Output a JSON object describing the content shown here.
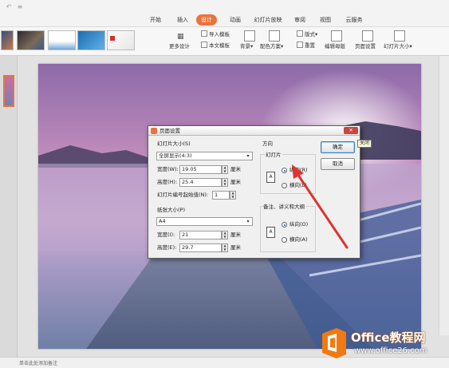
{
  "tabs": {
    "start": "开始",
    "insert": "插入",
    "design": "设计",
    "animation": "动画",
    "slideshow": "幻灯片放映",
    "review": "审阅",
    "view": "视图",
    "cloud": "云服务"
  },
  "ribbon": {
    "more_design": "更多设计",
    "import_template": "导入模板",
    "body_font": "本文模板",
    "background": "背景",
    "color_scheme": "配色方案",
    "layout": "版式",
    "reset": "重置",
    "edit_master": "编辑母版",
    "page_setup": "页面设置",
    "slide_size": "幻灯片大小"
  },
  "dialog": {
    "title": "页面设置",
    "slide_size_label": "幻灯片大小(S)",
    "slide_size_value": "全屏显示(4:3)",
    "width_label": "宽度(W):",
    "width_value": "19.05",
    "width_unit": "厘米",
    "height_label": "高度(H):",
    "height_value": "25.4",
    "height_unit": "厘米",
    "start_num_label": "幻灯片编号起始值(N):",
    "start_num_value": "1",
    "paper_label": "纸张大小(P)",
    "paper_value": "A4",
    "pwidth_label": "宽度(I):",
    "pwidth_value": "21",
    "pwidth_unit": "厘米",
    "pheight_label": "高度(E):",
    "pheight_value": "29.7",
    "pheight_unit": "厘米",
    "orientation_label": "方向",
    "slides_label": "幻灯片",
    "slides_portrait": "纵向(R)",
    "slides_landscape": "横向(L)",
    "notes_label": "备注、讲义和大纲",
    "notes_portrait": "纵向(O)",
    "notes_landscape": "横向(A)",
    "ok": "确定",
    "cancel": "取消",
    "close_tooltip": "关闭"
  },
  "statusbar": {
    "note": "单击此处添加备注"
  },
  "watermark": {
    "brand": "Office教程网",
    "url": "www.office26.com"
  },
  "colors": {
    "accent": "#e8743b",
    "arrow": "#e0322e",
    "logo_orange": "#f07a12"
  }
}
